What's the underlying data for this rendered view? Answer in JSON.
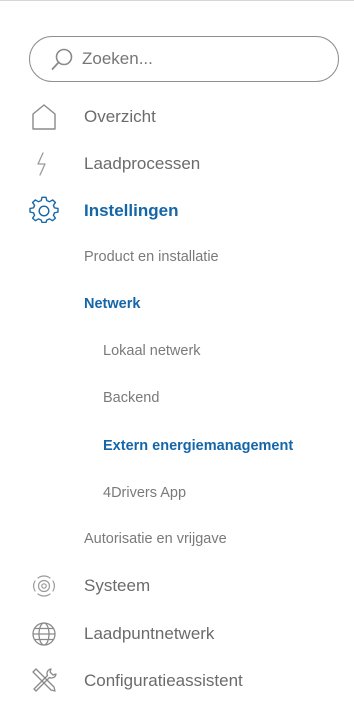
{
  "search": {
    "placeholder": "Zoeken..."
  },
  "nav": {
    "overzicht": "Overzicht",
    "laadprocessen": "Laadprocessen",
    "instellingen": "Instellingen",
    "systeem": "Systeem",
    "laadpuntnetwerk": "Laadpuntnetwerk",
    "configuratieassistent": "Configuratieassistent"
  },
  "instellingen_sub": {
    "product": "Product en installatie",
    "netwerk": "Netwerk",
    "netwerk_items": {
      "lokaal": "Lokaal netwerk",
      "backend": "Backend",
      "extern": "Extern energiemanagement",
      "app": "4Drivers App"
    },
    "autorisatie": "Autorisatie en vrijgave"
  },
  "colors": {
    "accent": "#1466a8",
    "text": "#6b6b6b",
    "icon": "#8a8a8a"
  },
  "icons": {
    "search": "search-icon",
    "overzicht": "home-icon",
    "laadprocessen": "lightning-icon",
    "instellingen": "gear-icon",
    "systeem": "system-icon",
    "laadpuntnetwerk": "globe-icon",
    "configuratieassistent": "tools-icon"
  }
}
